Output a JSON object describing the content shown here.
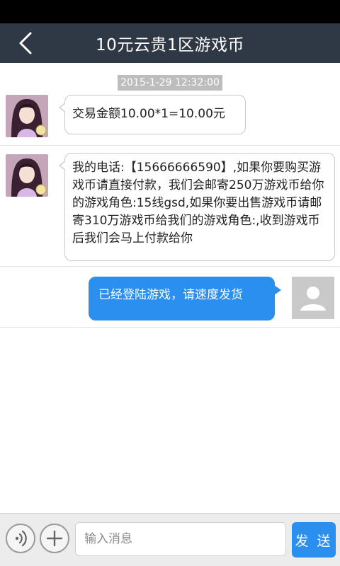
{
  "header": {
    "title": "10元云贵1区游戏币",
    "back_icon": "chevron-left-icon"
  },
  "chat": {
    "timestamp": "2015-1-29 12:32:00",
    "messages": [
      {
        "side": "left",
        "avatar": "anime-girl-avatar",
        "text": "交易金额10.00*1=10.00元"
      },
      {
        "side": "left",
        "avatar": "anime-girl-avatar",
        "text": "我的电话:【15666666590】,如果你要购买游戏币请直接付款，我们会邮寄250万游戏币给你的游戏角色:15线gsd,如果你要出售游戏币请邮寄310万游戏币给我们的游戏角色:,收到游戏币后我们会马上付款给你"
      },
      {
        "side": "right",
        "avatar": "default-user-avatar",
        "text": "已经登陆游戏，请速度发货"
      }
    ]
  },
  "input_bar": {
    "voice_icon": "voice-icon",
    "add_icon": "plus-icon",
    "placeholder": "输入消息",
    "send_label": "发 送"
  },
  "colors": {
    "title_bar": "#2f3845",
    "accent": "#2b8ff0",
    "timestamp_bg": "#bdbdbd"
  }
}
